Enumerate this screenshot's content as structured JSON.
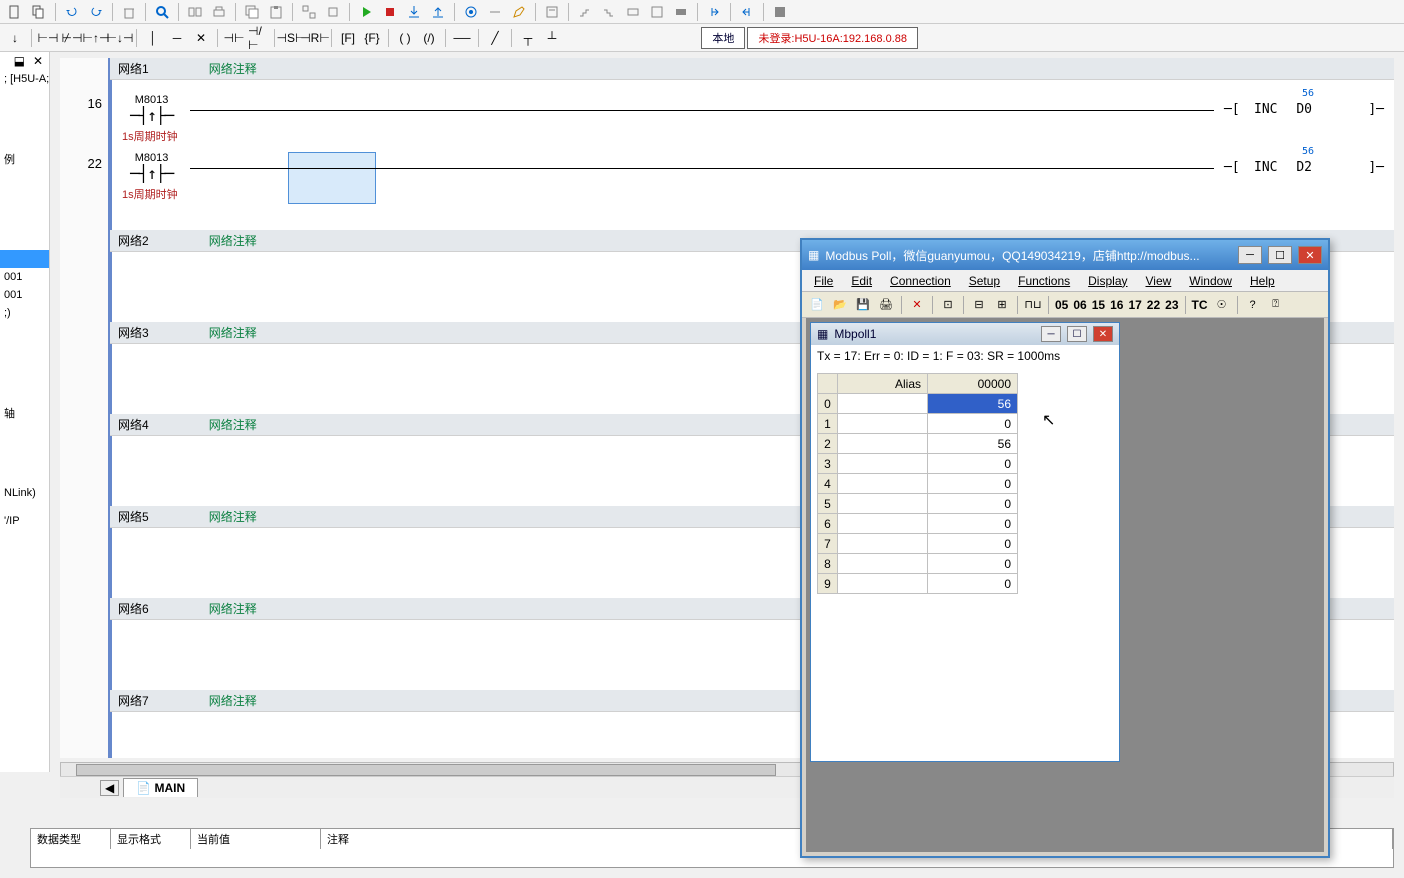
{
  "toolbar1_icons": [
    "new",
    "copy",
    "undo",
    "redo",
    "delete",
    "search",
    "connect",
    "print",
    "copy2",
    "paste",
    "ungroup",
    "group",
    "play",
    "stop",
    "download",
    "upload",
    "camera",
    "unknown",
    "edit",
    "note",
    "stairs",
    "stairs2",
    "block1",
    "block2",
    "block3",
    "in",
    "out",
    "book"
  ],
  "toolbar2_icons": [
    "down",
    "bracket1",
    "bracket2",
    "bracket3",
    "bracket4",
    "wire1",
    "wire2",
    "wire3",
    "cap1",
    "cap2",
    "coil1",
    "coil2",
    "func1",
    "func2",
    "paren1",
    "paren2",
    "line",
    "diag",
    "t1",
    "t2"
  ],
  "toolbar2_status": {
    "local": "本地",
    "login": "未登录:H5U-16A:192.168.0.88"
  },
  "left": {
    "close": "✕",
    "pin": "⬓",
    "project": "; [H5U-A;",
    "items": [
      "例",
      "001",
      "001",
      ";)",
      "轴",
      "NLink)",
      "'/IP"
    ]
  },
  "networks": [
    {
      "label": "网络1",
      "comment": "网络注释"
    },
    {
      "label": "网络2",
      "comment": "网络注释"
    },
    {
      "label": "网络3",
      "comment": "网络注释"
    },
    {
      "label": "网络4",
      "comment": "网络注释"
    },
    {
      "label": "网络5",
      "comment": "网络注释"
    },
    {
      "label": "网络6",
      "comment": "网络注释"
    },
    {
      "label": "网络7",
      "comment": "网络注释"
    }
  ],
  "rungs": [
    {
      "line": "16",
      "contact": "M8013",
      "note": "1s周期时钟",
      "instr": "INC",
      "reg": "D0",
      "val": "56"
    },
    {
      "line": "22",
      "contact": "M8013",
      "note": "1s周期时钟",
      "instr": "INC",
      "reg": "D2",
      "val": "56"
    }
  ],
  "main_tab": "MAIN",
  "bottom_headers": [
    "数据类型",
    "显示格式",
    "当前值",
    "注释"
  ],
  "modbus": {
    "title": "Modbus Poll，微信guanyumou，QQ149034219，店铺http://modbus...",
    "menu": [
      "File",
      "Edit",
      "Connection",
      "Setup",
      "Functions",
      "Display",
      "View",
      "Window",
      "Help"
    ],
    "fcodes": [
      "05",
      "06",
      "15",
      "16",
      "17",
      "22",
      "23"
    ],
    "tc": "TC",
    "child_title": "Mbpoll1",
    "status": "Tx = 17: Err = 0: ID = 1: F = 03: SR = 1000ms",
    "grid": {
      "header_alias": "Alias",
      "header_val": "00000",
      "rows": [
        {
          "idx": "0",
          "alias": "",
          "val": "56",
          "selected": true
        },
        {
          "idx": "1",
          "alias": "",
          "val": "0"
        },
        {
          "idx": "2",
          "alias": "",
          "val": "56"
        },
        {
          "idx": "3",
          "alias": "",
          "val": "0"
        },
        {
          "idx": "4",
          "alias": "",
          "val": "0"
        },
        {
          "idx": "5",
          "alias": "",
          "val": "0"
        },
        {
          "idx": "6",
          "alias": "",
          "val": "0"
        },
        {
          "idx": "7",
          "alias": "",
          "val": "0"
        },
        {
          "idx": "8",
          "alias": "",
          "val": "0"
        },
        {
          "idx": "9",
          "alias": "",
          "val": "0"
        }
      ]
    }
  }
}
